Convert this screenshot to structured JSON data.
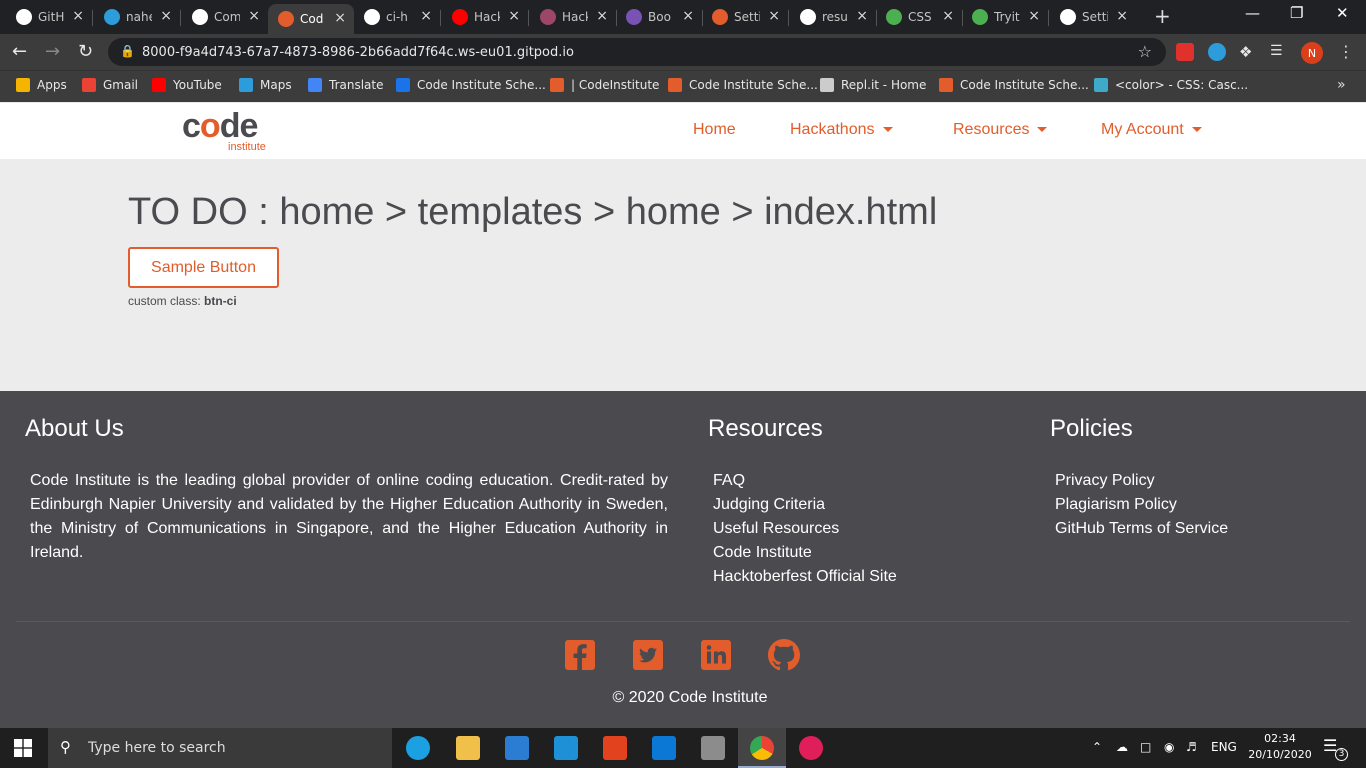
{
  "browser": {
    "tabs": [
      {
        "title": "GitH",
        "icon": "github-icon",
        "color": "#ffffff"
      },
      {
        "title": "nahe",
        "icon": "gitpod-icon",
        "color": "#2d9cdb"
      },
      {
        "title": "Com",
        "icon": "github-icon",
        "color": "#ffffff"
      },
      {
        "title": "Cod",
        "icon": "code-institute-icon",
        "color": "#e25d2b"
      },
      {
        "title": "ci-h",
        "icon": "github-icon",
        "color": "#ffffff"
      },
      {
        "title": "Hack",
        "icon": "youtube-icon",
        "color": "#ff0000"
      },
      {
        "title": "Hack",
        "icon": "hacktoberfest-icon",
        "color": "#9c4668"
      },
      {
        "title": "Boo",
        "icon": "bootstrap-icon",
        "color": "#7952b3"
      },
      {
        "title": "Setti",
        "icon": "code-institute-icon",
        "color": "#e25d2b"
      },
      {
        "title": "resu",
        "icon": "github-icon",
        "color": "#ffffff"
      },
      {
        "title": "CSS",
        "icon": "w3schools-icon",
        "color": "#4caf50"
      },
      {
        "title": "Tryit",
        "icon": "w3schools-icon",
        "color": "#4caf50"
      },
      {
        "title": "Setti",
        "icon": "gear-icon",
        "color": "#ffffff"
      }
    ],
    "url": "8000-f9a4d743-67a7-4873-8986-2b66add7f64c.ws-eu01.gitpod.io",
    "profile_initial": "N",
    "bookmarks": [
      {
        "label": "Apps",
        "color": "#f4b400"
      },
      {
        "label": "Gmail",
        "color": "#ea4335"
      },
      {
        "label": "YouTube",
        "color": "#ff0000"
      },
      {
        "label": "Maps",
        "color": "#2d9cdb"
      },
      {
        "label": "Translate",
        "color": "#4285f4"
      },
      {
        "label": "Code Institute Sche...",
        "color": "#1a73e8"
      },
      {
        "label": "| CodeInstitute",
        "color": "#e25d2b"
      },
      {
        "label": "Code Institute Sche...",
        "color": "#e25d2b"
      },
      {
        "label": "Repl.it - Home",
        "color": "#cccccc"
      },
      {
        "label": "Code Institute Sche...",
        "color": "#e25d2b"
      },
      {
        "label": "<color> - CSS: Casc...",
        "color": "#3fa9c9"
      }
    ]
  },
  "site": {
    "logo_text": "code",
    "logo_sub": "institute",
    "nav": {
      "home": "Home",
      "hackathons": "Hackathons",
      "resources": "Resources",
      "account": "My Account"
    },
    "heading": "TO DO : home > templates > home > index.html",
    "sample_button": "Sample Button",
    "custom_class_label": "custom class:",
    "custom_class_value": "btn-ci",
    "accent": "#e25d2b",
    "footer": {
      "about_title": "About Us",
      "about_text": "Code Institute is the leading global provider of online coding education. Credit-rated by Edinburgh Napier University and validated by the Higher Education Authority in Sweden, the Ministry of Communications in Singapore, and the Higher Education Authority in Ireland.",
      "resources_title": "Resources",
      "resources": [
        "FAQ",
        "Judging Criteria",
        "Useful Resources",
        "Code Institute",
        "Hacktoberfest Official Site"
      ],
      "policies_title": "Policies",
      "policies": [
        "Privacy Policy",
        "Plagiarism Policy",
        "GitHub Terms of Service"
      ],
      "social": [
        "facebook-icon",
        "twitter-icon",
        "linkedin-icon",
        "github-icon"
      ],
      "copyright": "© 2020 Code Institute"
    }
  },
  "taskbar": {
    "search_placeholder": "Type here to search",
    "language": "ENG",
    "time": "02:34",
    "date": "20/10/2020",
    "notifications": "3"
  }
}
